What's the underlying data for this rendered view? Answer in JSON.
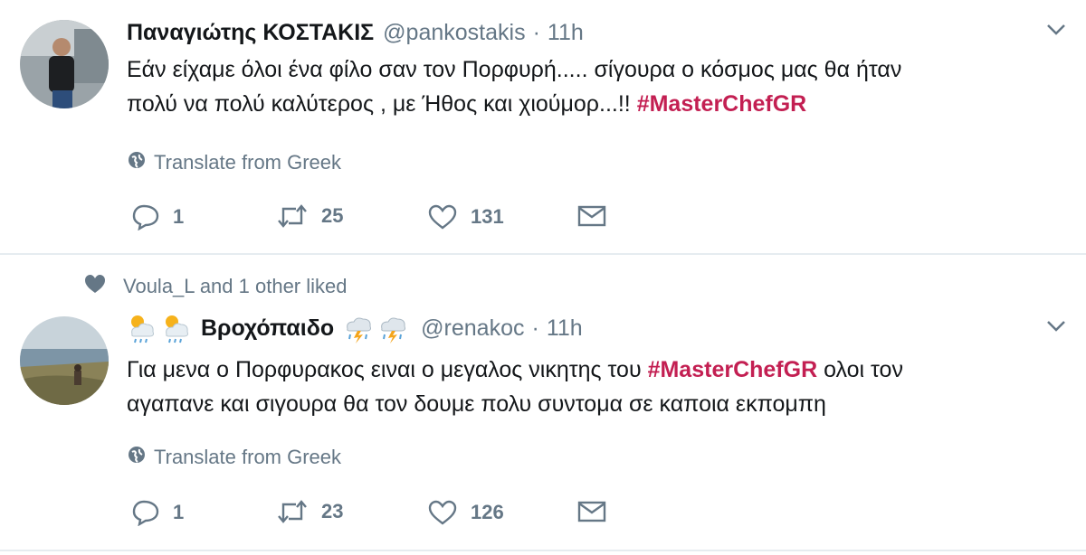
{
  "tweets": [
    {
      "name": "Παναγιώτης ΚΟΣΤΑΚΙΣ",
      "handle": "@pankostakis",
      "separator": "·",
      "time": "11h",
      "text_line1": "Εάν είχαμε όλοι ένα φίλο σαν τον Πορφυρή..... σίγουρα ο κόσμος μας θα ήταν",
      "text_line2_before": "πολύ να πολύ καλύτερος , με Ήθος και χιούμορ...!! ",
      "hashtag": "#MasterChefGR",
      "translate": "Translate from Greek",
      "replies": "1",
      "retweets": "25",
      "likes": "131"
    },
    {
      "social_context": "Voula_L and 1 other liked",
      "name": "Βροχόπαιδο",
      "handle": "@renakoc",
      "separator": "·",
      "time": "11h",
      "text_line1_before": "Για μενα ο Πορφυρακος ειναι ο μεγαλος νικητης του ",
      "hashtag": "#MasterChefGR",
      "text_line1_after": " ολοι τον",
      "text_line2": "αγαπανε και σιγουρα θα τον δουμε πολυ συντομα σε καποια εκπομπη",
      "translate": "Translate from Greek",
      "replies": "1",
      "retweets": "23",
      "likes": "126"
    }
  ],
  "colors": {
    "text": "#14171a",
    "secondary": "#657786",
    "hashtag": "#c31f52",
    "divider": "#e6ecf0"
  },
  "icons": [
    "avatar",
    "chevron-down-icon",
    "globe-icon",
    "reply-icon",
    "retweet-icon",
    "heart-icon",
    "envelope-icon",
    "weather-emoji"
  ]
}
